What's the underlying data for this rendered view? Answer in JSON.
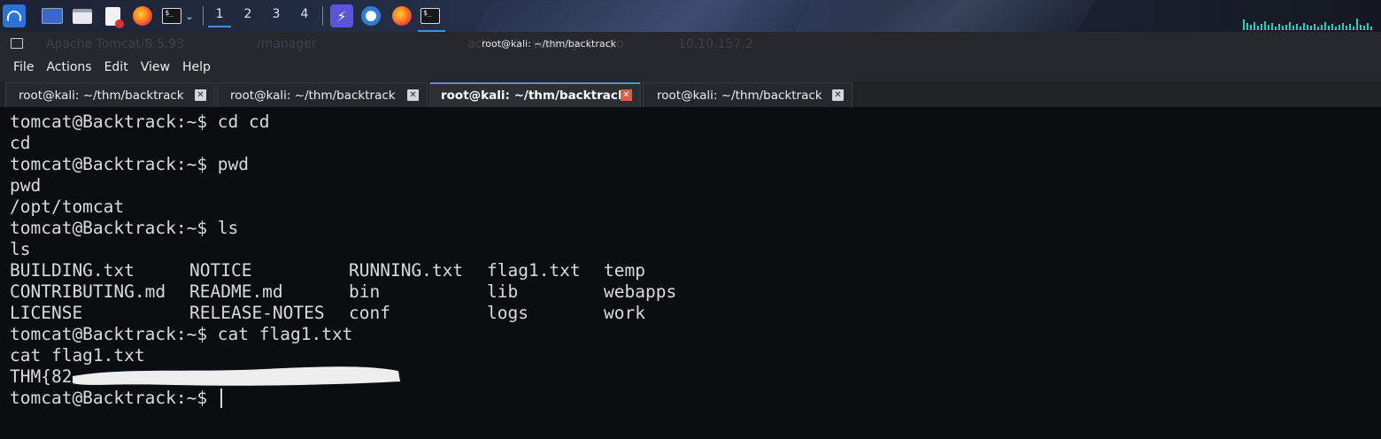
{
  "panel": {
    "workspaces": [
      "1",
      "2",
      "3",
      "4"
    ],
    "icons": [
      "kali-menu-icon",
      "terminal-icon",
      "file-manager-icon",
      "text-editor-icon",
      "firefox-icon",
      "terminal-dropdown-icon",
      "bolt-app-icon",
      "chromium-icon",
      "firefox-icon",
      "terminal-icon"
    ]
  },
  "window": {
    "title": "root@kali: ~/thm/backtrack",
    "ghost_tabs": [
      "Apache Tomcat/8.5.93",
      "/manager",
      "active: 0 · waiting: 0 · clo",
      "10.10.157.2"
    ],
    "menu": [
      "File",
      "Actions",
      "Edit",
      "View",
      "Help"
    ],
    "tabs": [
      {
        "label": "root@kali: ~/thm/backtrack",
        "active": false
      },
      {
        "label": "root@kali: ~/thm/backtrack",
        "active": false
      },
      {
        "label": "root@kali: ~/thm/backtrack",
        "active": true
      },
      {
        "label": "root@kali: ~/thm/backtrack",
        "active": false
      }
    ]
  },
  "terminal": {
    "lines": [
      "tomcat@Backtrack:~$ cd cd",
      "cd",
      "tomcat@Backtrack:~$ pwd",
      "pwd",
      "/opt/tomcat",
      "tomcat@Backtrack:~$ ls",
      "ls"
    ],
    "ls_columns": [
      [
        "BUILDING.txt",
        "CONTRIBUTING.md",
        "LICENSE"
      ],
      [
        "NOTICE",
        "README.md",
        "RELEASE-NOTES"
      ],
      [
        "RUNNING.txt",
        "bin",
        "conf"
      ],
      [
        "flag1.txt",
        "lib",
        "logs"
      ],
      [
        "temp",
        "webapps",
        "work"
      ]
    ],
    "after": [
      "tomcat@Backtrack:~$ cat flag1.txt",
      "cat flag1.txt",
      "THM{82",
      "tomcat@Backtrack:~$ "
    ]
  },
  "colors": {
    "terminal_bg": "#0c0d10",
    "terminal_fg": "#d8dade",
    "active_tab_close": "#e05a4a",
    "accent": "#3d8fe0"
  }
}
